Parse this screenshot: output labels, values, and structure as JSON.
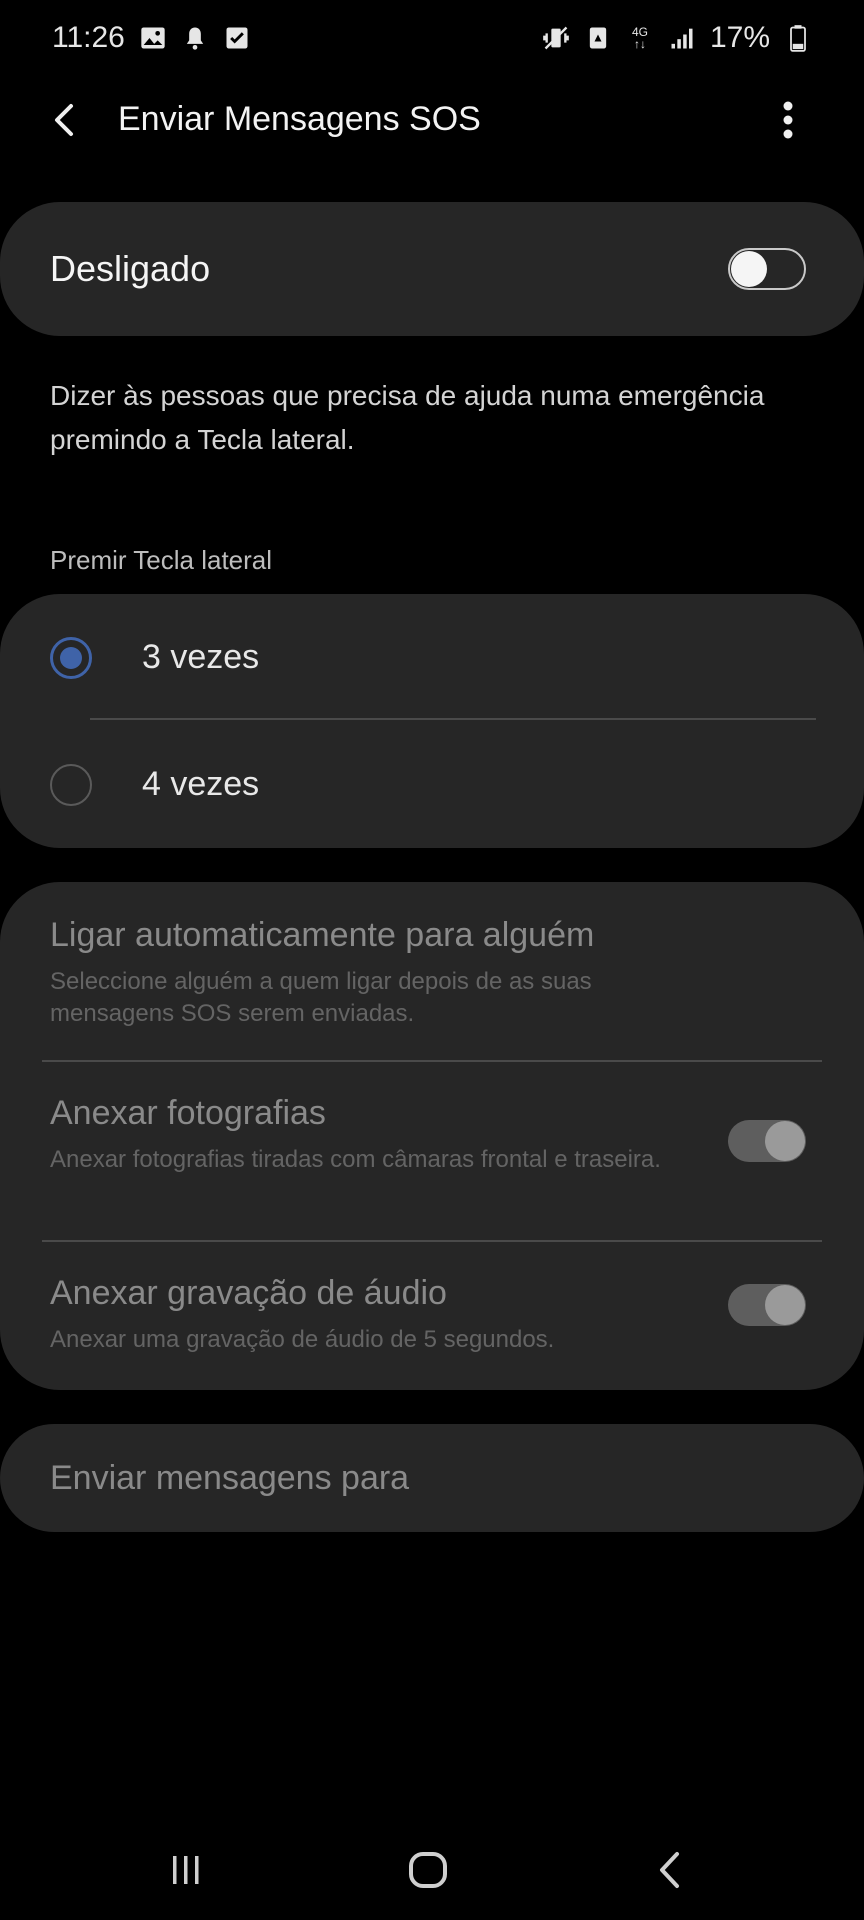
{
  "status_bar": {
    "time": "11:26",
    "network": "4G",
    "battery": "17%",
    "left_icons": [
      "gallery-icon",
      "notification-bell-icon",
      "checkbox-icon"
    ],
    "right_icons": [
      "vibrate-icon",
      "data-saver-icon",
      "network-4g-icon",
      "signal-icon",
      "battery-icon"
    ]
  },
  "app_bar": {
    "title": "Enviar Mensagens SOS"
  },
  "master_toggle": {
    "label": "Desligado",
    "state": "off"
  },
  "description": "Dizer às pessoas que precisa de ajuda numa emergência premindo a Tecla lateral.",
  "press_section": {
    "header": "Premir Tecla lateral",
    "options": [
      {
        "label": "3 vezes",
        "selected": true
      },
      {
        "label": "4 vezes",
        "selected": false
      }
    ]
  },
  "options": {
    "auto_call": {
      "title": "Ligar automaticamente para alguém",
      "subtitle": "Seleccione alguém a quem ligar depois de as suas mensagens SOS serem enviadas."
    },
    "attach_photos": {
      "title": "Anexar fotografias",
      "subtitle": "Anexar fotografias tiradas com câmaras frontal e traseira.",
      "state": "on"
    },
    "attach_audio": {
      "title": "Anexar gravação de áudio",
      "subtitle": "Anexar uma gravação de áudio de 5 segundos.",
      "state": "on"
    }
  },
  "recipients": {
    "label": "Enviar mensagens para"
  },
  "colors": {
    "background": "#000000",
    "card": "#262626",
    "accent": "#3f63a8"
  }
}
